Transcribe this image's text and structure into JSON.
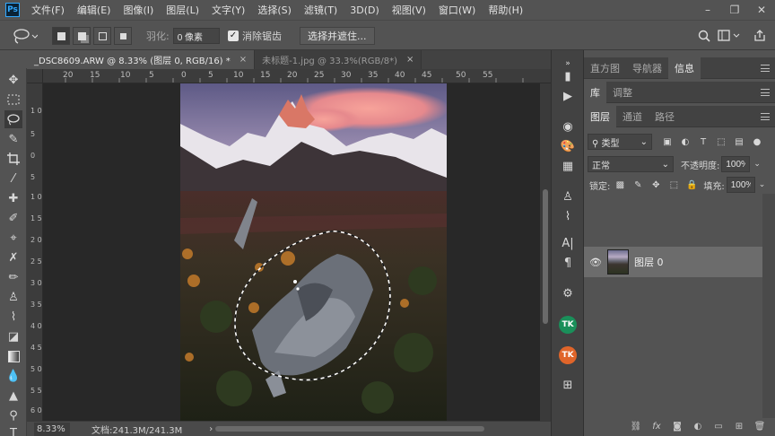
{
  "menu": {
    "logo": "Ps",
    "items": [
      "文件(F)",
      "编辑(E)",
      "图像(I)",
      "图层(L)",
      "文字(Y)",
      "选择(S)",
      "滤镜(T)",
      "3D(D)",
      "视图(V)",
      "窗口(W)",
      "帮助(H)"
    ],
    "window_controls": [
      "minimize",
      "restore",
      "close"
    ]
  },
  "options": {
    "feather_label": "羽化:",
    "feather_value": "0 像素",
    "antialias_label": "消除锯齿",
    "antialias_checked": true,
    "select_mask_button": "选择并遮住..."
  },
  "documents": {
    "tabs": [
      {
        "label": "_DSC8609.ARW @ 8.33% (图层 0, RGB/16) *",
        "active": true
      },
      {
        "label": "未标题-1.jpg @ 33.3%(RGB/8*)",
        "active": false
      }
    ]
  },
  "rulers": {
    "top": [
      "20",
      "15",
      "10",
      "5",
      "0",
      "5",
      "10",
      "15",
      "20",
      "25",
      "30",
      "35",
      "40",
      "45",
      "50",
      "55"
    ],
    "left": [
      "1 0",
      "5",
      "0",
      "5",
      "1 0",
      "1 5",
      "2 0",
      "2 5",
      "3 0",
      "3 5",
      "4 0",
      "4 5",
      "5 0",
      "5 5",
      "6 0"
    ]
  },
  "status": {
    "zoom": "8.33%",
    "doc_size": "文档:241.3M/241.3M",
    "arrow": "›"
  },
  "panels": {
    "top_tabs": [
      {
        "label": "直方图",
        "active": false
      },
      {
        "label": "导航器",
        "active": false
      },
      {
        "label": "信息",
        "active": true
      }
    ],
    "mid_tabs": [
      {
        "label": "库",
        "active": true
      },
      {
        "label": "调整",
        "active": false
      }
    ],
    "layer_tabs": [
      {
        "label": "图层",
        "active": true
      },
      {
        "label": "通道",
        "active": false
      },
      {
        "label": "路径",
        "active": false
      }
    ],
    "filter_type": "类型",
    "blend_mode": "正常",
    "opacity_label": "不透明度:",
    "opacity_value": "100%",
    "lock_label": "锁定:",
    "fill_label": "填充:",
    "fill_value": "100%",
    "layer_name": "图层 0"
  },
  "colors": {
    "ui_bg": "#535353",
    "canvas_bg": "#282828",
    "tk_green": "#1a8f5a",
    "tk_orange": "#e0652a",
    "ps_blue": "#31a8ff"
  }
}
